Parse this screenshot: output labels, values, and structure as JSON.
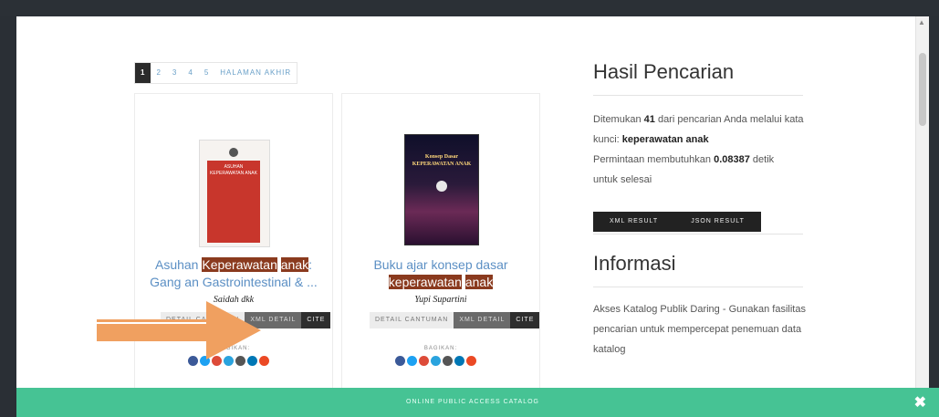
{
  "pager": {
    "pages": [
      "1",
      "2",
      "3",
      "4",
      "5"
    ],
    "last": "HALAMAN AKHIR"
  },
  "cards": [
    {
      "title_pre": "Asuhan ",
      "title_hl1": "Keperawatan",
      "title_mid": " ",
      "title_hl2": "anak",
      "title_post": ":",
      "title_line2": "Gang  an Gastrointestinal & ...",
      "author": "Saidah dkk",
      "buttons": [
        "DETAIL CANTUMAN",
        "XML DETAIL",
        "CITE"
      ],
      "share_label": "BAGIKAN:",
      "cover_title": "ASUHAN KEPERAWATAN ANAK"
    },
    {
      "title_pre": "Buku ajar konsep dasar",
      "title_hl1": "keperawatan",
      "title_mid": " ",
      "title_hl2": "anak",
      "author": "Yupi Supartini",
      "buttons": [
        "DETAIL CANTUMAN",
        "XML DETAIL",
        "CITE"
      ],
      "share_label": "BAGIKAN:",
      "cover_title": "Konsep Dasar KEPERAWATAN ANAK"
    }
  ],
  "sidebar": {
    "results_title": "Hasil Pencarian",
    "found_pre": "Ditemukan ",
    "found_count": "41",
    "found_post": " dari pencarian Anda melalui kata",
    "keyword_pre": "kunci: ",
    "keyword": "keperawatan anak",
    "time_pre": "Permintaan membutuhkan ",
    "time_value": "0.08387",
    "time_post": " detik",
    "time_line2": "untuk selesai",
    "xml_result": "XML RESULT",
    "json_result": "JSON RESULT",
    "info_title": "Informasi",
    "info_text": "Akses Katalog Publik Daring - Gunakan fasilitas pencarian untuk mempercepat penemuan data katalog"
  },
  "footer": {
    "text": "ONLINE PUBLIC ACCESS CATALOG",
    "close": "✖"
  },
  "colors": {
    "footer": "#46c394",
    "highlight": "#8a3a1e",
    "link": "#5b8fc4",
    "arrow": "#f0a060"
  },
  "share_icons": [
    "facebook-icon",
    "twitter-icon",
    "google-plus-icon",
    "telegram-icon",
    "reddit-icon",
    "linkedin-icon",
    "stumbleupon-icon"
  ]
}
